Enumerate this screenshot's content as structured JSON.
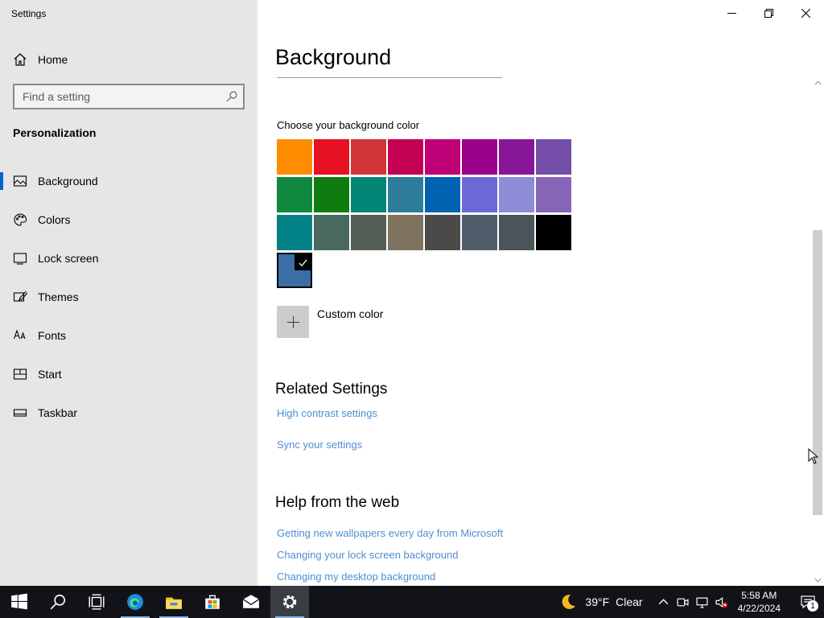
{
  "window": {
    "title": "Settings"
  },
  "sidebar": {
    "home_label": "Home",
    "search_placeholder": "Find a setting",
    "section_title": "Personalization",
    "items": [
      {
        "label": "Background",
        "icon": "picture-icon",
        "active": true
      },
      {
        "label": "Colors",
        "icon": "palette-icon"
      },
      {
        "label": "Lock screen",
        "icon": "lock-screen-icon"
      },
      {
        "label": "Themes",
        "icon": "themes-brush-icon"
      },
      {
        "label": "Fonts",
        "icon": "fonts-icon"
      },
      {
        "label": "Start",
        "icon": "start-icon"
      },
      {
        "label": "Taskbar",
        "icon": "taskbar-icon"
      }
    ]
  },
  "main": {
    "title": "Background",
    "choose_label": "Choose your background color",
    "swatch_rows": [
      [
        "#ff8c00",
        "#e81123",
        "#d13438",
        "#c30052",
        "#bf0077",
        "#9a0089",
        "#881798",
        "#744da9"
      ],
      [
        "#10893e",
        "#107c10",
        "#018574",
        "#2d7d9a",
        "#0063b1",
        "#6b69d6",
        "#8e8cd8",
        "#8764b8"
      ],
      [
        "#038387",
        "#486860",
        "#525e54",
        "#7e735f",
        "#4c4a48",
        "#515c6b",
        "#4a5459",
        "#000000"
      ]
    ],
    "selected_color": "#3a6ea5",
    "custom_color_label": "Custom color",
    "related_settings": {
      "heading": "Related Settings",
      "links": [
        "High contrast settings",
        "Sync your settings"
      ]
    },
    "help": {
      "heading": "Help from the web",
      "links": [
        "Getting new wallpapers every day from Microsoft",
        "Changing your lock screen background",
        "Changing my desktop background"
      ]
    }
  },
  "taskbar": {
    "apps": [
      "windows-start-icon",
      "search-icon",
      "task-view-icon",
      "edge-icon",
      "file-explorer-icon",
      "store-icon",
      "mail-icon",
      "settings-gear-icon"
    ],
    "weather": {
      "temp": "39°F",
      "condition": "Clear"
    },
    "clock": {
      "time": "5:58 AM",
      "date": "4/22/2024"
    },
    "notification_count": "1"
  },
  "colors": {
    "accent": "#0a64c8",
    "link": "#4d8fd1",
    "sidebar_bg": "#e6e6e6",
    "taskbar_bg": "#111318"
  }
}
